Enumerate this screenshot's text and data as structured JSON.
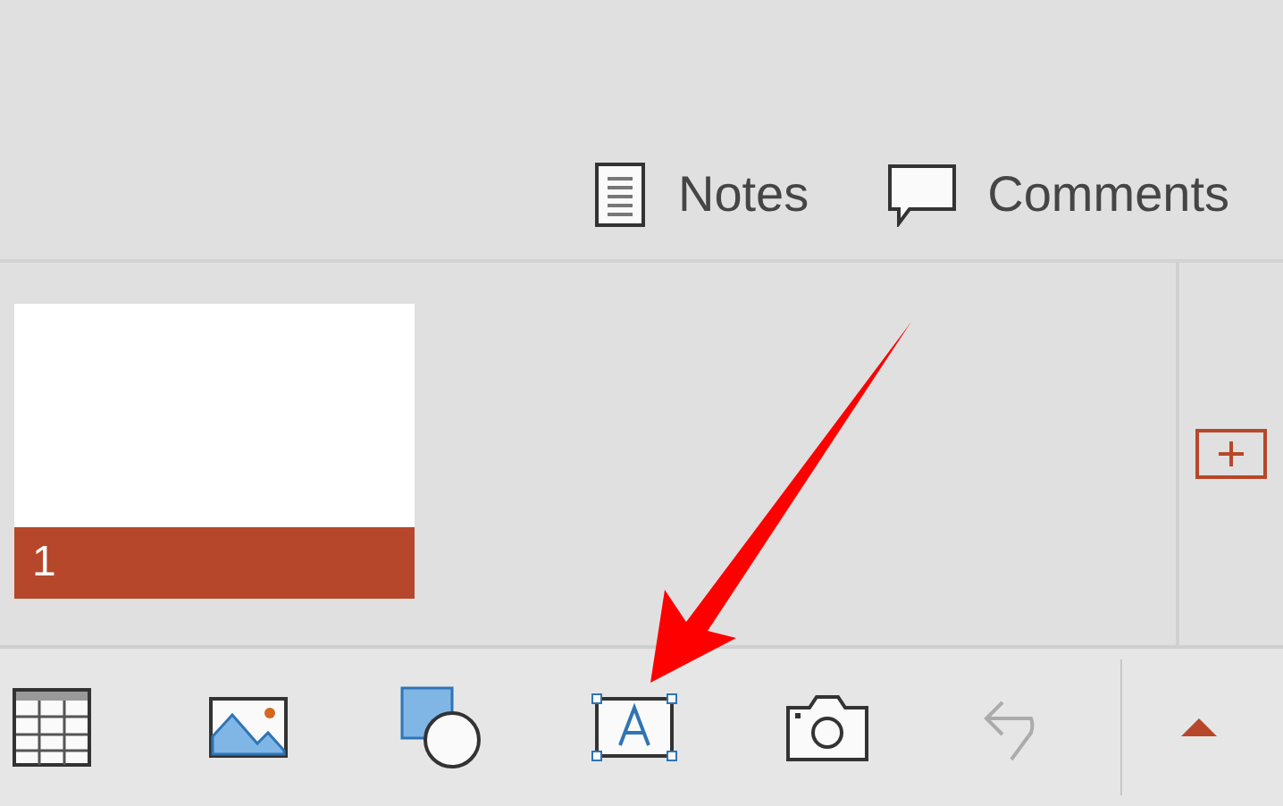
{
  "view_buttons": [
    {
      "kind": "notes",
      "label": "Notes"
    },
    {
      "kind": "comments",
      "label": "Comments"
    }
  ],
  "slides": [
    {
      "number": "1",
      "selected": true
    }
  ],
  "toolbar": [
    {
      "kind": "table",
      "disabled": false
    },
    {
      "kind": "picture",
      "disabled": false
    },
    {
      "kind": "shapes",
      "disabled": false
    },
    {
      "kind": "textbox",
      "disabled": false
    },
    {
      "kind": "camera",
      "disabled": false
    },
    {
      "kind": "undo",
      "disabled": true
    }
  ]
}
